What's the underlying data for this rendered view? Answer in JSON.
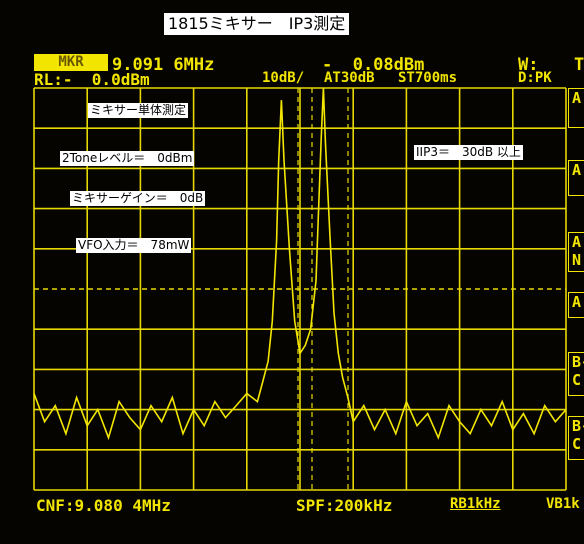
{
  "title": "1815ミキサー　IP3測定",
  "header": {
    "marker_tag": "MKR",
    "marker_freq": "9.091 6MHz",
    "marker_level": "-  0.08dBm",
    "w_label": "W:",
    "t_label": "T",
    "ref_level": "RL:-  0.0dBm",
    "scale": "10dB/",
    "attenuation": "AT30dB",
    "sweep_time": "ST700ms",
    "detector": "D:PK"
  },
  "notes": {
    "mixer_alone": "ミキサー単体測定",
    "two_tone_level": "2Toneレベル＝　0dBm",
    "mixer_gain": "ミキサーゲイン＝　0dB",
    "vfo_input": "VFO入力＝　78mW",
    "iip3": "IIP3＝　30dB 以上"
  },
  "softkeys": [
    "A",
    "A",
    "A",
    "N",
    "A",
    "B-",
    "C",
    "B-",
    "C"
  ],
  "footer": {
    "center_freq": "CNF:9.080 4MHz",
    "span": "SPF:200kHz",
    "rbw": "RB1kHz",
    "vbw": "VB1k"
  },
  "chart_data": {
    "type": "line",
    "title": "",
    "xlabel": "",
    "ylabel": "",
    "center_freq_MHz": 9.0804,
    "span_kHz": 200,
    "ref_level_dBm": 0.0,
    "scale_dB_per_div": 10,
    "x_divisions": 10,
    "y_divisions": 10,
    "grid": true,
    "series": [
      {
        "x_MHz": [
          8.9804,
          8.9844,
          8.9884,
          8.9924,
          8.9964,
          9.0004,
          9.0044,
          9.0084,
          9.0124,
          9.0164,
          9.0204,
          9.0244,
          9.0284,
          9.0324,
          9.0364,
          9.0404,
          9.0444,
          9.0484,
          9.0524,
          9.0564,
          9.0604,
          9.0644,
          9.0664,
          9.0684,
          9.07,
          9.0716,
          9.0724,
          9.0734,
          9.0744,
          9.0764,
          9.0784,
          9.0804,
          9.0824,
          9.0844,
          9.0864,
          9.0874,
          9.0884,
          9.0892,
          9.09,
          9.0916,
          9.0932,
          9.0948,
          9.0964,
          9.0984,
          9.1004,
          9.1044,
          9.1084,
          9.1124,
          9.1164,
          9.1204,
          9.1244,
          9.1284,
          9.1324,
          9.1364,
          9.1404,
          9.1444,
          9.1484,
          9.1524,
          9.1564,
          9.1604,
          9.1644,
          9.1684,
          9.1724,
          9.1764,
          9.1804
        ],
        "y_dBm": [
          -76,
          -83,
          -79,
          -86,
          -77,
          -84,
          -80,
          -87,
          -78,
          -82,
          -85,
          -79,
          -83,
          -77,
          -86,
          -80,
          -84,
          -78,
          -82,
          -79,
          -76,
          -78,
          -73,
          -68,
          -58,
          -38,
          -18,
          -3,
          -18,
          -40,
          -58,
          -66,
          -64,
          -60,
          -48,
          -30,
          -12,
          0,
          -14,
          -36,
          -56,
          -66,
          -72,
          -77,
          -83,
          -79,
          -85,
          -80,
          -86,
          -78,
          -84,
          -81,
          -87,
          -79,
          -83,
          -86,
          -80,
          -84,
          -78,
          -85,
          -81,
          -86,
          -79,
          -83,
          -80
        ]
      }
    ]
  }
}
